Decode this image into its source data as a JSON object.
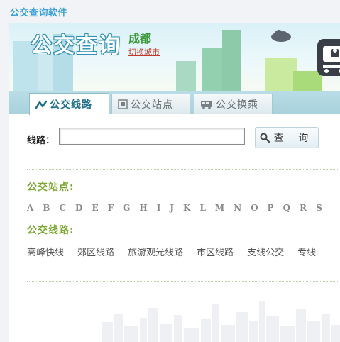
{
  "window": {
    "title": "公交查询软件"
  },
  "banner": {
    "logo_text": "公交查询",
    "city": "成都",
    "switch_city": "切换城市"
  },
  "tabs": [
    {
      "label": "公交线路",
      "icon": "route-icon",
      "active": true
    },
    {
      "label": "公交站点",
      "icon": "station-icon",
      "active": false
    },
    {
      "label": "公交换乘",
      "icon": "transfer-bus-icon",
      "active": false
    }
  ],
  "search": {
    "label": "线路：",
    "value": "",
    "button": "查 询",
    "button_icon": "magnifier-icon"
  },
  "stations": {
    "title": "公交站点:",
    "letters": [
      "A",
      "B",
      "C",
      "D",
      "E",
      "F",
      "G",
      "H",
      "I",
      "J",
      "K",
      "L",
      "M",
      "N",
      "O",
      "P",
      "Q",
      "R",
      "S"
    ]
  },
  "routes": {
    "title": "公交线路:",
    "categories": [
      "高峰快线",
      "郊区线路",
      "旅游观光线路",
      "市区线路",
      "支线公交",
      "专线"
    ]
  },
  "colors": {
    "title": "#3aa0d8",
    "section": "#7aa82f",
    "city": "#3a9a3a",
    "link": "#c0392b"
  }
}
